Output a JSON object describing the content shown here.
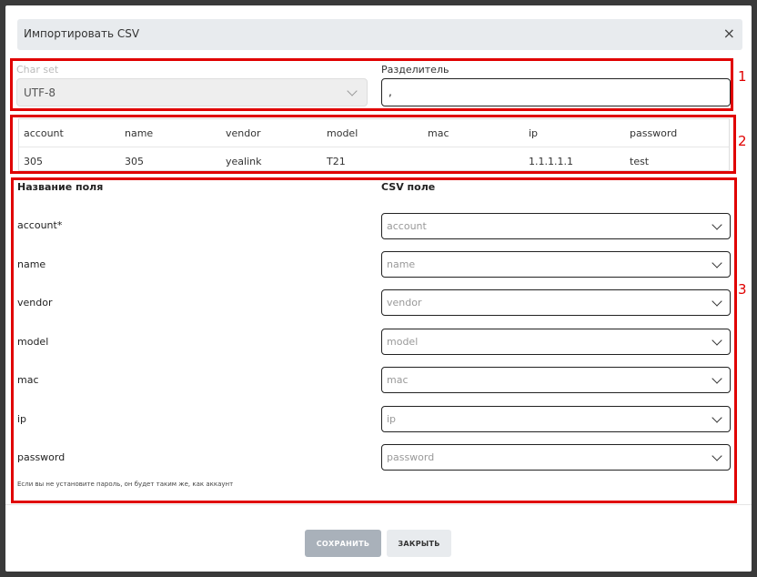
{
  "dialog": {
    "title": "Импортировать CSV",
    "close_symbol": "×"
  },
  "settings": {
    "charset_label": "Char set",
    "charset_value": "UTF-8",
    "separator_label": "Разделитель",
    "separator_value": ","
  },
  "preview": {
    "headers": [
      "account",
      "name",
      "vendor",
      "model",
      "mac",
      "ip",
      "password"
    ],
    "row": [
      "305",
      "305",
      "yealink",
      "T21",
      "",
      "1.1.1.1.1",
      "test"
    ]
  },
  "mapping": {
    "field_header": "Название поля",
    "csv_header": "CSV поле",
    "fields": [
      {
        "label": "account*",
        "placeholder": "account"
      },
      {
        "label": "name",
        "placeholder": "name"
      },
      {
        "label": "vendor",
        "placeholder": "vendor"
      },
      {
        "label": "model",
        "placeholder": "model"
      },
      {
        "label": "mac",
        "placeholder": "mac"
      },
      {
        "label": "ip",
        "placeholder": "ip"
      },
      {
        "label": "password",
        "placeholder": "password"
      }
    ],
    "hint": "Если вы не установите пароль, он будет таким же, как аккаунт"
  },
  "annotations": [
    "1",
    "2",
    "3"
  ],
  "footer": {
    "save_label": "СОХРАНИТЬ",
    "close_label": "ЗАКРЫТЬ"
  },
  "colors": {
    "annotation_red": "#e00000",
    "save_button_disabled": "#a9b1ba",
    "header_bg": "#e8ebee"
  }
}
